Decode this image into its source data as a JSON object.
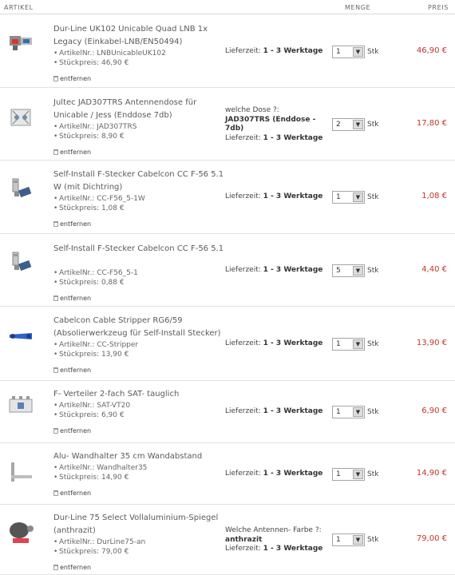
{
  "header": {
    "artikel": "ARTIKEL",
    "menge": "MENGE",
    "preis": "PREIS"
  },
  "labels": {
    "artikelnr": "ArtikelNr.:",
    "stueckpreis": "Stückpreis:",
    "entfernen": "entfernen",
    "lieferzeit_prefix": "Lieferzeit:",
    "lieferzeit_value": "1 - 3 Werktage",
    "stk": "Stk"
  },
  "items": [
    {
      "name": "Dur-Line UK102 Unicable Quad LNB 1x Legacy (Einkabel-LNB/EN50494)",
      "artikelnr": "LNBUnicableUK102",
      "stueckpreis": "46,90 €",
      "option_label": "",
      "option_value": "",
      "qty": "1",
      "price": "46,90 €",
      "icon": "lnb-icon"
    },
    {
      "name": "Jultec JAD307TRS Antennendose für Unicable / Jess (Enddose 7db)",
      "artikelnr": "JAD307TRS",
      "stueckpreis": "8,90 €",
      "option_label": "welche Dose ?:",
      "option_value": "JAD307TRS (Enddose - 7db)",
      "qty": "2",
      "price": "17,80 €",
      "icon": "antenna-socket-icon"
    },
    {
      "name": "Self-Install F-Stecker Cabelcon CC F-56 5.1 W (mit Dichtring)",
      "artikelnr": "CC-F56_5-1W",
      "stueckpreis": "1,08 €",
      "option_label": "",
      "option_value": "",
      "qty": "1",
      "price": "1,08 €",
      "icon": "f-connector-icon"
    },
    {
      "name": "Self-Install F-Stecker Cabelcon CC F-56 5.1",
      "artikelnr": "CC-F56_5-1",
      "stueckpreis": "0,88 €",
      "option_label": "",
      "option_value": "",
      "qty": "5",
      "price": "4,40 €",
      "icon": "f-connector-icon"
    },
    {
      "name": "Cabelcon Cable Stripper RG6/59 (Absolierwerkzeug für Self-Install Stecker)",
      "artikelnr": "CC-Stripper",
      "stueckpreis": "13,90 €",
      "option_label": "",
      "option_value": "",
      "qty": "1",
      "price": "13,90 €",
      "icon": "cable-stripper-icon"
    },
    {
      "name": "F- Verteiler 2-fach SAT- tauglich",
      "artikelnr": "SAT-VT20",
      "stueckpreis": "6,90 €",
      "option_label": "",
      "option_value": "",
      "qty": "1",
      "price": "6,90 €",
      "icon": "splitter-icon"
    },
    {
      "name": "Alu- Wandhalter 35 cm Wandabstand",
      "artikelnr": "Wandhalter35",
      "stueckpreis": "14,90 €",
      "option_label": "",
      "option_value": "",
      "qty": "1",
      "price": "14,90 €",
      "icon": "wall-bracket-icon"
    },
    {
      "name": "Dur-Line 75 Select Vollaluminium-Spiegel (anthrazit)",
      "artikelnr": "DurLine75-an",
      "stueckpreis": "79,00 €",
      "option_label": "Welche Antennen- Farbe ?:",
      "option_value": "anthrazit",
      "qty": "1",
      "price": "79,00 €",
      "icon": "satellite-dish-icon"
    }
  ]
}
